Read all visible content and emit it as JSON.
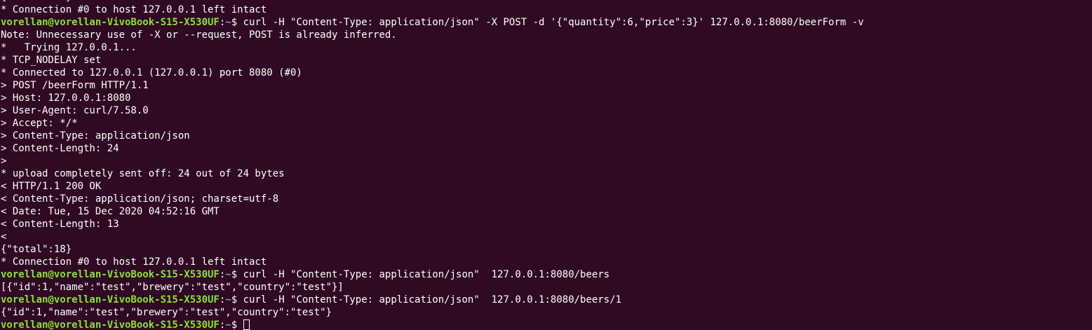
{
  "prompt": {
    "user_host": "vorellan@vorellan-VivoBook-S15-X530UF",
    "separator": ":",
    "path": "~",
    "symbol": "$"
  },
  "lines": [
    {
      "kind": "output",
      "text": "{\"total\":18}"
    },
    {
      "kind": "output",
      "text": "* Connection #0 to host 127.0.0.1 left intact"
    },
    {
      "kind": "command",
      "text": " curl -H \"Content-Type: application/json\" -X POST -d '{\"quantity\":6,\"price\":3}' 127.0.0.1:8080/beerForm -v"
    },
    {
      "kind": "output",
      "text": "Note: Unnecessary use of -X or --request, POST is already inferred."
    },
    {
      "kind": "output",
      "text": "*   Trying 127.0.0.1..."
    },
    {
      "kind": "output",
      "text": "* TCP_NODELAY set"
    },
    {
      "kind": "output",
      "text": "* Connected to 127.0.0.1 (127.0.0.1) port 8080 (#0)"
    },
    {
      "kind": "output",
      "text": "> POST /beerForm HTTP/1.1"
    },
    {
      "kind": "output",
      "text": "> Host: 127.0.0.1:8080"
    },
    {
      "kind": "output",
      "text": "> User-Agent: curl/7.58.0"
    },
    {
      "kind": "output",
      "text": "> Accept: */*"
    },
    {
      "kind": "output",
      "text": "> Content-Type: application/json"
    },
    {
      "kind": "output",
      "text": "> Content-Length: 24"
    },
    {
      "kind": "output",
      "text": ">"
    },
    {
      "kind": "output",
      "text": "* upload completely sent off: 24 out of 24 bytes"
    },
    {
      "kind": "output",
      "text": "< HTTP/1.1 200 OK"
    },
    {
      "kind": "output",
      "text": "< Content-Type: application/json; charset=utf-8"
    },
    {
      "kind": "output",
      "text": "< Date: Tue, 15 Dec 2020 04:52:16 GMT"
    },
    {
      "kind": "output",
      "text": "< Content-Length: 13"
    },
    {
      "kind": "output",
      "text": "<"
    },
    {
      "kind": "output",
      "text": "{\"total\":18}"
    },
    {
      "kind": "output",
      "text": "* Connection #0 to host 127.0.0.1 left intact"
    },
    {
      "kind": "command",
      "text": " curl -H \"Content-Type: application/json\"  127.0.0.1:8080/beers"
    },
    {
      "kind": "output",
      "text": "[{\"id\":1,\"name\":\"test\",\"brewery\":\"test\",\"country\":\"test\"}]"
    },
    {
      "kind": "command",
      "text": " curl -H \"Content-Type: application/json\"  127.0.0.1:8080/beers/1"
    },
    {
      "kind": "output",
      "text": "{\"id\":1,\"name\":\"test\",\"brewery\":\"test\",\"country\":\"test\"}"
    },
    {
      "kind": "input",
      "text": " "
    }
  ],
  "colors": {
    "background": "#300a24",
    "text": "#ffffff",
    "prompt_user": "#8ae234",
    "prompt_path": "#729fcf"
  }
}
